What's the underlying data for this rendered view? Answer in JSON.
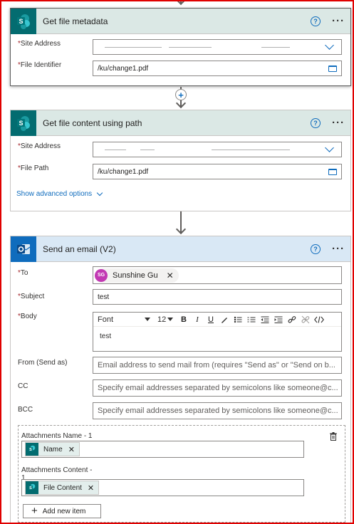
{
  "card1": {
    "title": "Get file metadata",
    "site_address_label": "Site Address",
    "file_identifier_label": "File Identifier",
    "file_identifier_value": "/ku/change1.pdf"
  },
  "card2": {
    "title": "Get file content using path",
    "site_address_label": "Site Address",
    "file_path_label": "File Path",
    "file_path_value": "/ku/change1.pdf",
    "show_advanced": "Show advanced options"
  },
  "card3": {
    "title": "Send an email (V2)",
    "to_label": "To",
    "to_avatar": "SG",
    "to_name": "Sunshine Gu",
    "subject_label": "Subject",
    "subject_value": "test",
    "body_label": "Body",
    "font_label": "Font",
    "font_size": "12",
    "body_value": "test",
    "from_label": "From (Send as)",
    "from_placeholder": "Email address to send mail from (requires \"Send as\" or \"Send on b...",
    "cc_label": "CC",
    "cc_placeholder": "Specify email addresses separated by semicolons like someone@c...",
    "bcc_label": "BCC",
    "bcc_placeholder": "Specify email addresses separated by semicolons like someone@c...",
    "attachments_name_label": "Attachments Name - 1",
    "attachments_name_token": "Name",
    "attachments_content_label": "Attachments Content -\n1",
    "attachments_content_token": "File Content",
    "add_new_item": "Add new item"
  },
  "common": {
    "required_mark": "*",
    "help_glyph": "?",
    "more_glyph": "···",
    "plus_glyph": "+"
  },
  "colors": {
    "sharepoint_tile": "#036c70",
    "outlook_tile": "#0f6cbd",
    "accent": "#0f6cbd",
    "selection_border": "#e00000",
    "avatar": "#c239b3"
  },
  "icons": [
    "sharepoint-icon",
    "outlook-icon",
    "help-icon",
    "more-icon",
    "chevron-down-icon",
    "folder-icon",
    "trash-icon",
    "add-icon"
  ]
}
